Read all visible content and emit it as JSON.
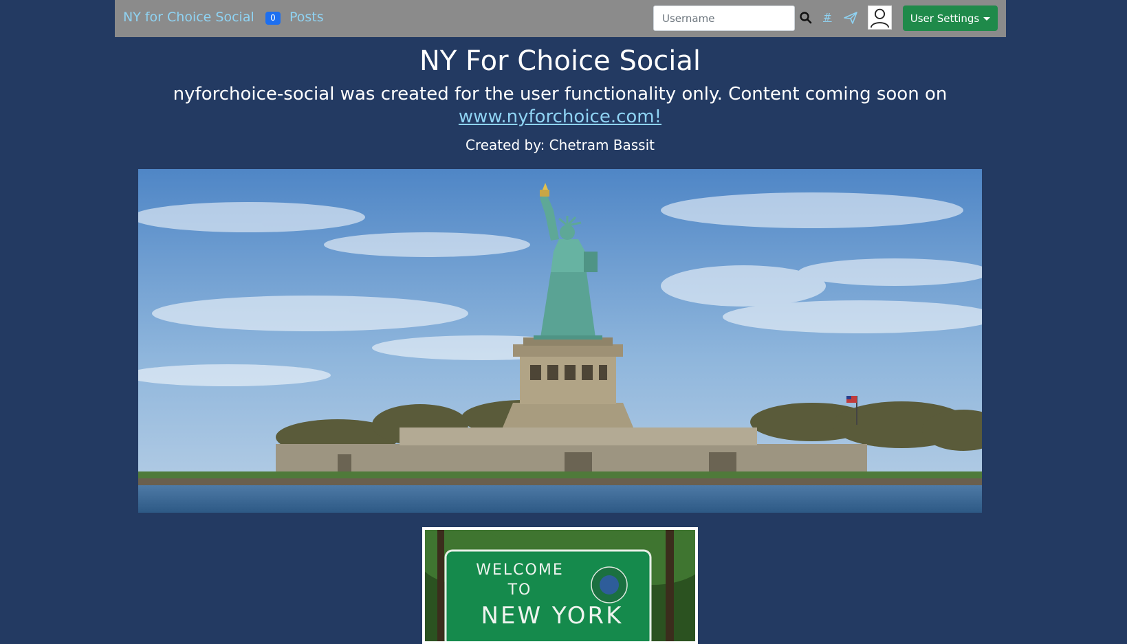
{
  "navbar": {
    "brand": "NY for Choice Social",
    "post_count": "0",
    "posts_label": "Posts",
    "search_placeholder": "Username",
    "hash_label": "#",
    "settings_label": "User Settings"
  },
  "main": {
    "title": "NY For Choice Social",
    "subtitle": "nyforchoice-social was created for the user functionality only. Content coming soon on",
    "link_text": "www.nyforchoice.com!",
    "creator": "Created by: Chetram Bassit"
  },
  "sign": {
    "line1": "WELCOME",
    "line2": "TO",
    "line3": "NEW YORK"
  },
  "colors": {
    "background": "#233a62",
    "navbar": "#8b8b8b",
    "link": "#8fd3f3",
    "badge": "#1d6ff0",
    "settings_button": "#1f8a4a"
  }
}
